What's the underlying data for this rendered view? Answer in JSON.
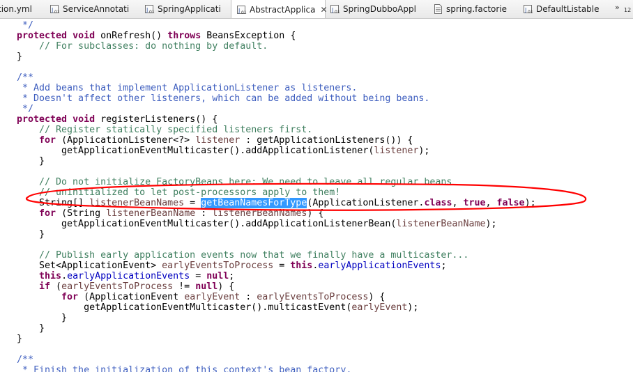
{
  "tabs": [
    {
      "label": "tion.yml",
      "icon": "yaml-file-icon",
      "active": false
    },
    {
      "label": "ServiceAnnotati",
      "icon": "java-class-icon",
      "active": false
    },
    {
      "label": "SpringApplicati",
      "icon": "java-class-icon",
      "active": false
    },
    {
      "label": "AbstractApplica",
      "icon": "java-class-icon",
      "active": true,
      "close": "✕"
    },
    {
      "label": "SpringDubboAppl",
      "icon": "java-class-icon",
      "active": false
    },
    {
      "label": "spring.factorie",
      "icon": "text-file-icon",
      "active": false
    },
    {
      "label": "DefaultListable",
      "icon": "java-class-icon",
      "active": false
    }
  ],
  "overflow": {
    "chevron": "»",
    "count": "12"
  },
  "colors": {
    "keyword": "#7f0055",
    "comment": "#3f7f5f",
    "javadoc": "#3f5fbf",
    "field": "#0000c0",
    "variable": "#6a3e3e",
    "selection": "#3399ff",
    "annotation_ellipse": "#ff0000"
  },
  "code_lines": [
    [
      {
        "t": " */",
        "c": "jd"
      }
    ],
    [
      {
        "t": "protected",
        "c": "kw"
      },
      {
        "t": " "
      },
      {
        "t": "void",
        "c": "kw"
      },
      {
        "t": " onRefresh() "
      },
      {
        "t": "throws",
        "c": "kw"
      },
      {
        "t": " BeansException {"
      }
    ],
    [
      {
        "t": "    // For subclasses: do nothing by default.",
        "c": "cm"
      }
    ],
    [
      {
        "t": "}"
      }
    ],
    [],
    [
      {
        "t": "/**",
        "c": "jd"
      }
    ],
    [
      {
        "t": " * Add beans that implement ApplicationListener as listeners.",
        "c": "jd"
      }
    ],
    [
      {
        "t": " * Doesn't affect other listeners, which can be added without being beans.",
        "c": "jd"
      }
    ],
    [
      {
        "t": " */",
        "c": "jd"
      }
    ],
    [
      {
        "t": "protected",
        "c": "kw"
      },
      {
        "t": " "
      },
      {
        "t": "void",
        "c": "kw"
      },
      {
        "t": " registerListeners() {"
      }
    ],
    [
      {
        "t": "    // Register statically specified listeners first.",
        "c": "cm"
      }
    ],
    [
      {
        "t": "    "
      },
      {
        "t": "for",
        "c": "kw"
      },
      {
        "t": " (ApplicationListener<?> "
      },
      {
        "t": "listener",
        "c": "vr"
      },
      {
        "t": " : getApplicationListeners()) {"
      }
    ],
    [
      {
        "t": "        getApplicationEventMulticaster().addApplicationListener("
      },
      {
        "t": "listener",
        "c": "vr"
      },
      {
        "t": ");"
      }
    ],
    [
      {
        "t": "    }"
      }
    ],
    [],
    [
      {
        "t": "    // Do not initialize FactoryBeans here: We need to leave all regular beans",
        "c": "cm"
      }
    ],
    [
      {
        "t": "    // uninitialized to let post-processors apply to them!",
        "c": "cm"
      }
    ],
    [
      {
        "t": "    String[] "
      },
      {
        "t": "listenerBeanNames",
        "c": "vr"
      },
      {
        "t": " = "
      },
      {
        "t": "getBeanNamesForType",
        "c": "sel"
      },
      {
        "t": "(ApplicationListener."
      },
      {
        "t": "class",
        "c": "kw"
      },
      {
        "t": ", "
      },
      {
        "t": "true",
        "c": "kw"
      },
      {
        "t": ", "
      },
      {
        "t": "false",
        "c": "kw"
      },
      {
        "t": ");"
      }
    ],
    [
      {
        "t": "    "
      },
      {
        "t": "for",
        "c": "kw"
      },
      {
        "t": " (String "
      },
      {
        "t": "listenerBeanName",
        "c": "vr"
      },
      {
        "t": " : "
      },
      {
        "t": "listenerBeanNames",
        "c": "vr"
      },
      {
        "t": ") {"
      }
    ],
    [
      {
        "t": "        getApplicationEventMulticaster().addApplicationListenerBean("
      },
      {
        "t": "listenerBeanName",
        "c": "vr"
      },
      {
        "t": ");"
      }
    ],
    [
      {
        "t": "    }"
      }
    ],
    [],
    [
      {
        "t": "    // Publish early application events now that we finally have a multicaster...",
        "c": "cm"
      }
    ],
    [
      {
        "t": "    Set<ApplicationEvent> "
      },
      {
        "t": "earlyEventsToProcess",
        "c": "vr"
      },
      {
        "t": " = "
      },
      {
        "t": "this",
        "c": "kw"
      },
      {
        "t": "."
      },
      {
        "t": "earlyApplicationEvents",
        "c": "fld"
      },
      {
        "t": ";"
      }
    ],
    [
      {
        "t": "    "
      },
      {
        "t": "this",
        "c": "kw"
      },
      {
        "t": "."
      },
      {
        "t": "earlyApplicationEvents",
        "c": "fld"
      },
      {
        "t": " = "
      },
      {
        "t": "null",
        "c": "kw"
      },
      {
        "t": ";"
      }
    ],
    [
      {
        "t": "    "
      },
      {
        "t": "if",
        "c": "kw"
      },
      {
        "t": " ("
      },
      {
        "t": "earlyEventsToProcess",
        "c": "vr"
      },
      {
        "t": " != "
      },
      {
        "t": "null",
        "c": "kw"
      },
      {
        "t": ") {"
      }
    ],
    [
      {
        "t": "        "
      },
      {
        "t": "for",
        "c": "kw"
      },
      {
        "t": " (ApplicationEvent "
      },
      {
        "t": "earlyEvent",
        "c": "vr"
      },
      {
        "t": " : "
      },
      {
        "t": "earlyEventsToProcess",
        "c": "vr"
      },
      {
        "t": ") {"
      }
    ],
    [
      {
        "t": "            getApplicationEventMulticaster().multicastEvent("
      },
      {
        "t": "earlyEvent",
        "c": "vr"
      },
      {
        "t": ");"
      }
    ],
    [
      {
        "t": "        }"
      }
    ],
    [
      {
        "t": "    }"
      }
    ],
    [
      {
        "t": "}"
      }
    ],
    [],
    [
      {
        "t": "/**",
        "c": "jd"
      }
    ],
    [
      {
        "t": " * Finish the initialization of this context's bean factory,",
        "c": "jd"
      }
    ]
  ]
}
